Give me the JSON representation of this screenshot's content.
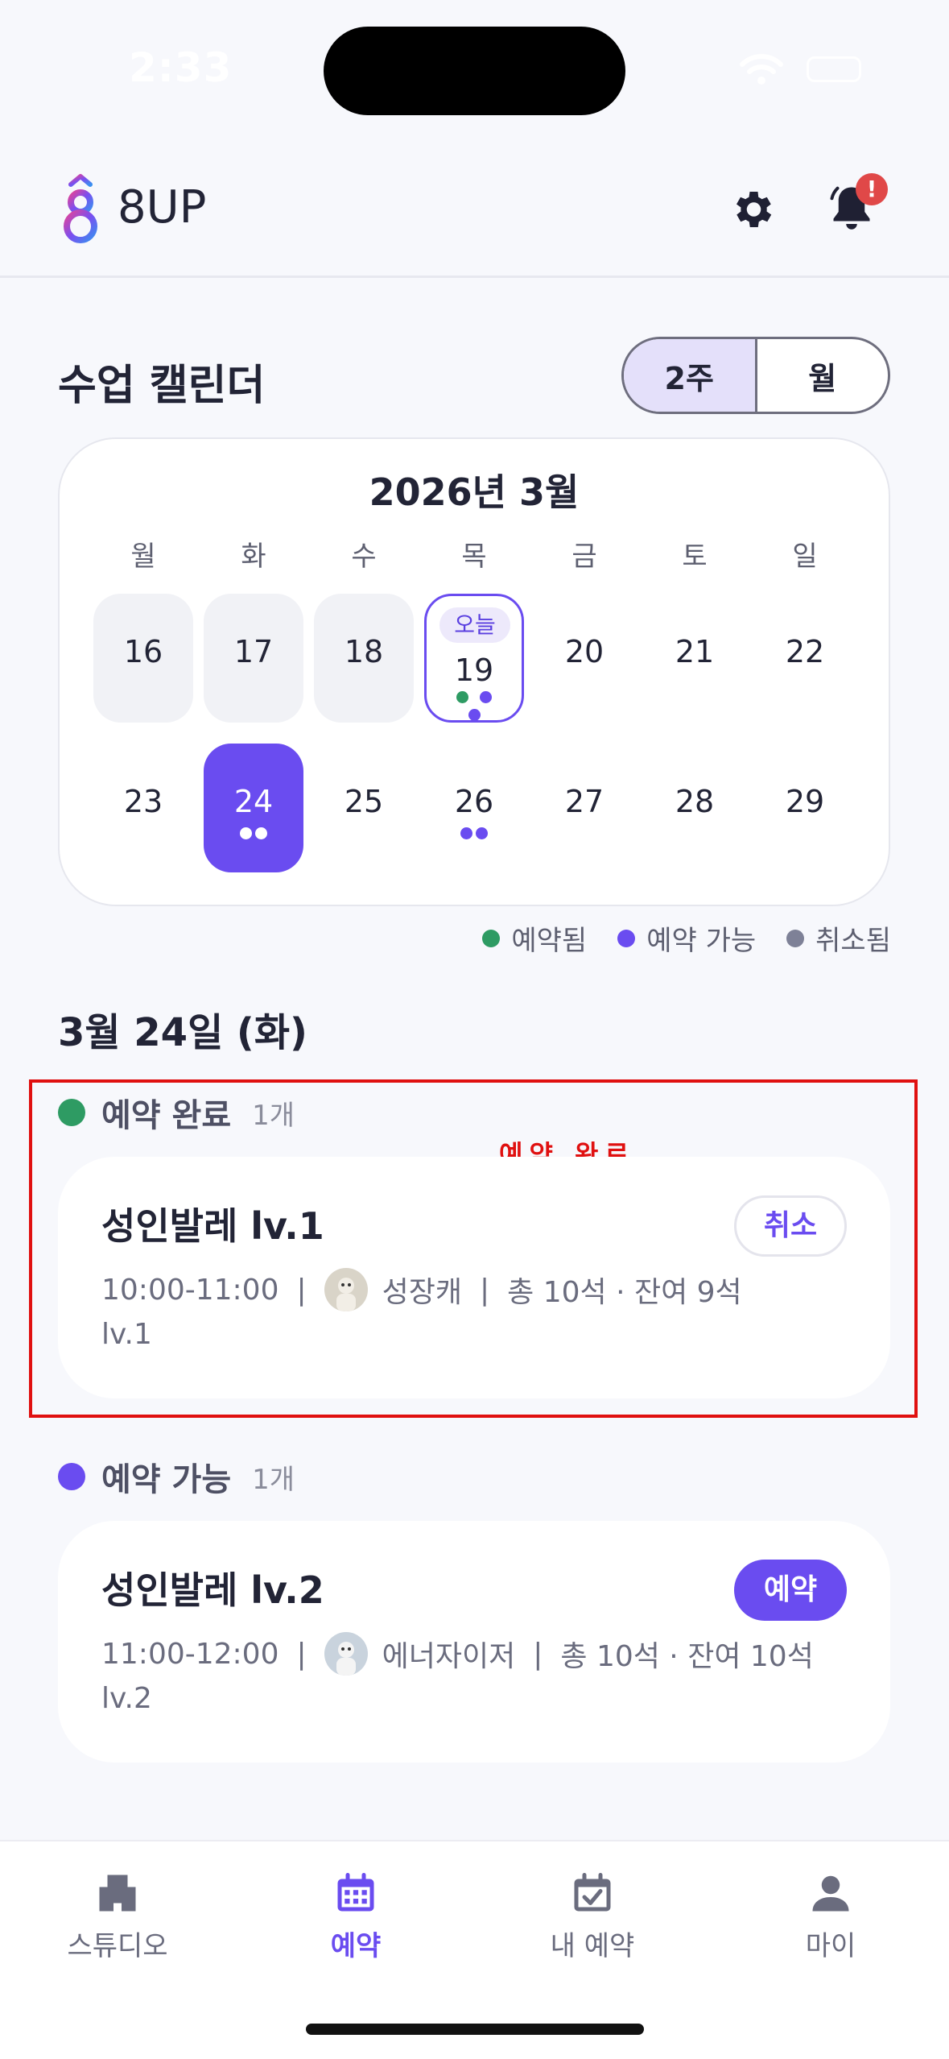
{
  "status_bar": {
    "time": "2:33"
  },
  "header": {
    "app_name": "8UP",
    "notification_badge": "!"
  },
  "calendar_section": {
    "title": "수업 캘린더",
    "toggle": {
      "two_week": "2주",
      "month": "월",
      "selected": "2주"
    },
    "month_title": "2026년 3월",
    "weekdays": [
      "월",
      "화",
      "수",
      "목",
      "금",
      "토",
      "일"
    ],
    "today_label": "오늘",
    "weeks": [
      [
        "16",
        "17",
        "18",
        "19",
        "20",
        "21",
        "22"
      ],
      [
        "23",
        "24",
        "25",
        "26",
        "27",
        "28",
        "29"
      ]
    ],
    "today": "19",
    "selected": "24"
  },
  "legend": {
    "booked": "예약됨",
    "available": "예약 가능",
    "cancelled": "취소됨"
  },
  "colors": {
    "booked": "#2E9B63",
    "available": "#6A4CF0",
    "cancelled": "#7E8197",
    "accent": "#6A4CF0",
    "highlight": "#E01010"
  },
  "selected_date": "3월 24일 (화)",
  "booked_group": {
    "label": "예약 완료",
    "count": "1개",
    "annotation": "예약 완료",
    "card": {
      "name": "성인발레 lv.1",
      "time": "10:00-11:00",
      "instructor": "성장캐",
      "seats": "총 10석 · 잔여 9석",
      "level": "lv.1",
      "button": "취소"
    }
  },
  "available_group": {
    "label": "예약 가능",
    "count": "1개",
    "card": {
      "name": "성인발레 lv.2",
      "time": "11:00-12:00",
      "instructor": "에너자이저",
      "seats": "총 10석 · 잔여 10석",
      "level": "lv.2",
      "button": "예약"
    }
  },
  "tabbar": {
    "tabs": [
      {
        "label": "스튜디오",
        "icon": "building-icon"
      },
      {
        "label": "예약",
        "icon": "calendar-icon"
      },
      {
        "label": "내 예약",
        "icon": "calendar-check-icon"
      },
      {
        "label": "마이",
        "icon": "person-icon"
      }
    ],
    "active": "예약"
  }
}
